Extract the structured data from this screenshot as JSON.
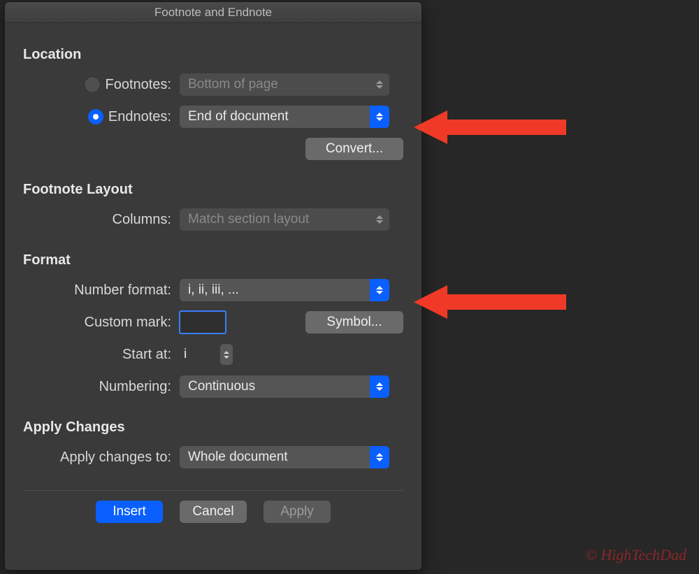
{
  "title": "Footnote and Endnote",
  "sections": {
    "location": {
      "title": "Location",
      "footnotes_label": "Footnotes:",
      "footnotes_value": "Bottom of page",
      "footnotes_selected": false,
      "endnotes_label": "Endnotes:",
      "endnotes_value": "End of document",
      "endnotes_selected": true,
      "convert_label": "Convert..."
    },
    "footnote_layout": {
      "title": "Footnote Layout",
      "columns_label": "Columns:",
      "columns_value": "Match section layout"
    },
    "format": {
      "title": "Format",
      "number_format_label": "Number format:",
      "number_format_value": "i, ii, iii, ...",
      "custom_mark_label": "Custom mark:",
      "custom_mark_value": "",
      "symbol_label": "Symbol...",
      "start_at_label": "Start at:",
      "start_at_value": "i",
      "numbering_label": "Numbering:",
      "numbering_value": "Continuous"
    },
    "apply_changes": {
      "title": "Apply Changes",
      "apply_to_label": "Apply changes to:",
      "apply_to_value": "Whole document"
    }
  },
  "buttons": {
    "insert": "Insert",
    "cancel": "Cancel",
    "apply": "Apply"
  },
  "watermark": "© HighTechDad"
}
